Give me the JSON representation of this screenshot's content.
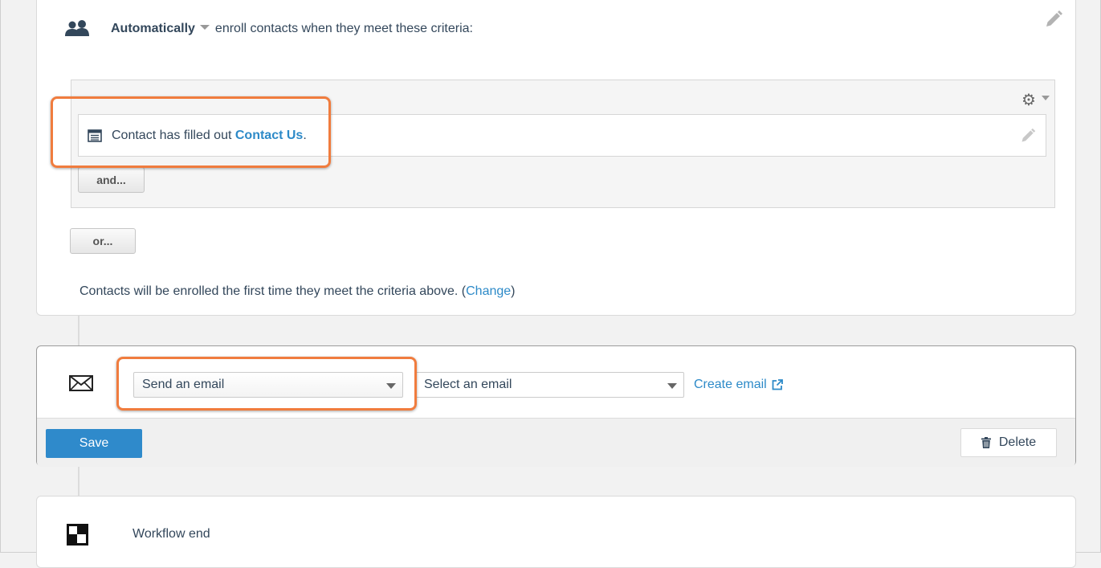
{
  "enrollment": {
    "mode_label": "Automatically",
    "rest_text": "enroll contacts when they meet these criteria:",
    "filter": {
      "prefix": "Contact has filled out",
      "form_name": "Contact Us",
      "suffix": "."
    },
    "and_label": "and...",
    "or_label": "or...",
    "note_prefix": "Contacts will be enrolled the first time they meet the criteria above. (",
    "change_label": "Change",
    "note_suffix": ")"
  },
  "action": {
    "action_type": "Send an email",
    "email_select_placeholder": "Select an email",
    "create_email_label": "Create email",
    "save_label": "Save",
    "delete_label": "Delete"
  },
  "workflow_end": {
    "label": "Workflow end"
  },
  "icons": {
    "enroll": "people-icon",
    "edit": "pencil-icon",
    "settings": "gear-icon",
    "form": "form-icon",
    "action": "envelope-icon",
    "external": "external-link-icon",
    "delete": "trash-icon",
    "end": "checkered-flag-icon"
  },
  "colors": {
    "link": "#2d8ac8",
    "primary_button": "#2f8acb",
    "highlight": "#f07c3e"
  }
}
